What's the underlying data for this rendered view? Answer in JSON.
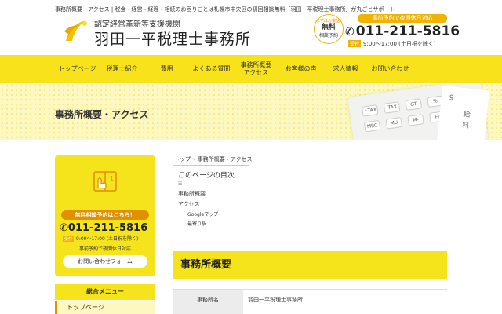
{
  "header": {
    "tagline": "事務所概要・アクセス | 税金・経営・経理・相続のお困りごとは札幌市中央区の初回相談無料「羽田一平税理士事務所」が丸ごとサポート",
    "logo_sub": "認定経営革新等支援機関",
    "logo_name": "羽田一平税理士事務所",
    "badge_top": "まずはお電話!",
    "badge_main": "無料",
    "badge_sub": "相談予約",
    "note": "事前予約で夜間休日対応",
    "phone": "011-211-5816",
    "hours_tag": "受付",
    "hours": "9:00～17:00 (土日祝を除く)"
  },
  "nav": {
    "items": [
      {
        "label": "トップページ"
      },
      {
        "label": "税理士紹介"
      },
      {
        "label": "費用"
      },
      {
        "label": "よくある質問"
      },
      {
        "label": "事務所概要アクセス"
      },
      {
        "label": "お客様の声"
      },
      {
        "label": "求人情報"
      },
      {
        "label": "お問い合わせ"
      }
    ]
  },
  "hero": {
    "title": "事務所概要・アクセス",
    "calc_keys": [
      "+TAX",
      "-TAX",
      "GT",
      "%",
      "MRC",
      "MU",
      "M-",
      "+/-"
    ],
    "paper_chars": [
      "9",
      "給",
      "料"
    ]
  },
  "sidebar": {
    "cta_head": "無料相談予約はこちら！",
    "cta_phone": "011-211-5816",
    "cta_hours_tag": "受付",
    "cta_hours": "9:00～17:00 (土日祝を除く)",
    "cta_note": "事前予約で夜間休日対応",
    "cta_button": "お問い合わせフォーム",
    "menu_head": "総合メニュー",
    "menu_first": "トップページ",
    "book_number": "1"
  },
  "breadcrumb": {
    "home": "トップ",
    "current": "事務所概要・アクセス"
  },
  "toc": {
    "title": "このページの目次",
    "toggle": "☰",
    "items": [
      {
        "label": "事務所概要"
      },
      {
        "label": "アクセス"
      }
    ],
    "subitems": [
      {
        "label": "Googleマップ"
      },
      {
        "label": "最寄り駅"
      }
    ]
  },
  "main": {
    "section_title": "事務所概要",
    "rows": [
      {
        "label": "事務所名",
        "value": "羽田一平税理士事務所"
      }
    ]
  },
  "colors": {
    "brand_yellow": "#f7e21c",
    "accent_orange": "#e09000"
  }
}
